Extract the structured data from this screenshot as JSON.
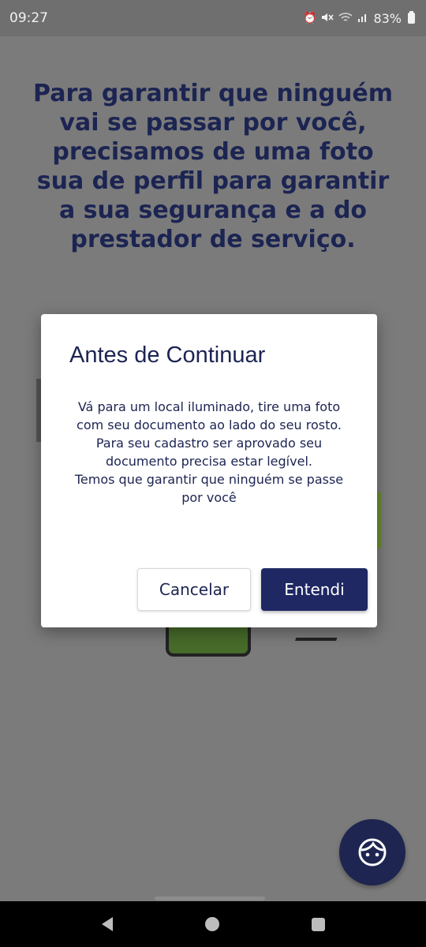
{
  "status_bar": {
    "time": "09:27",
    "battery": "83%",
    "icons": [
      "alarm-icon",
      "mute-icon",
      "wifi-icon",
      "signal-icon",
      "battery-icon"
    ]
  },
  "screen": {
    "headline": "Para garantir que ninguém vai se passar por você, precisamos de uma foto sua de perfil para garantir a sua segurança e a do prestador de serviço."
  },
  "dialog": {
    "title": "Antes de Continuar",
    "body_lines": [
      "Vá para um local iluminado, tire uma foto com seu documento ao lado do seu rosto.",
      "Para seu cadastro ser aprovado seu documento precisa estar legível.",
      "Temos que garantir que ninguém se passe por você"
    ],
    "cancel_label": "Cancelar",
    "ok_label": "Entendi"
  },
  "fab": {
    "icon": "face-icon"
  },
  "nav_bar": {
    "icons": [
      "back-icon",
      "home-icon",
      "recent-apps-icon"
    ]
  },
  "colors": {
    "primary": "#1f2863",
    "overlay": "#7b7b7b",
    "text": "#1c2452"
  }
}
